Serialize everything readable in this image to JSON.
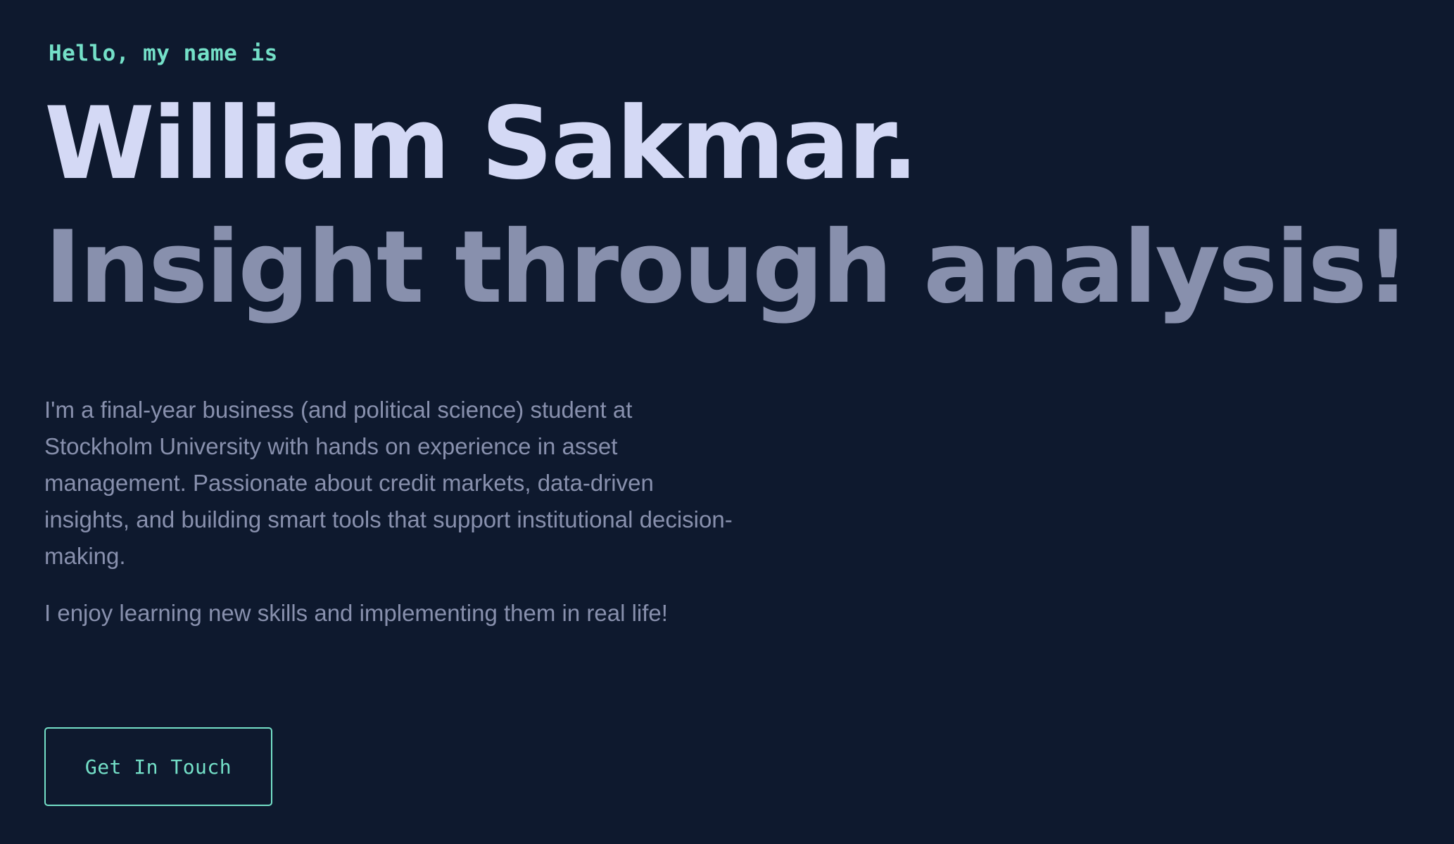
{
  "hero": {
    "intro": "Hello, my name is",
    "name": "William Sakmar.",
    "tagline": "Insight through analysis!",
    "bio": "I'm a final-year business (and political science) student at Stockholm University with hands on experience in asset management. Passionate about credit markets, data-driven insights, and building smart tools that support institutional decision-making.",
    "bio_secondary": "I enjoy learning new skills and implementing them in real life!",
    "cta_label": "Get In Touch"
  },
  "colors": {
    "background": "#0e192e",
    "accent": "#74e0c8",
    "heading": "#d4d9f5",
    "muted": "#8890ad"
  }
}
